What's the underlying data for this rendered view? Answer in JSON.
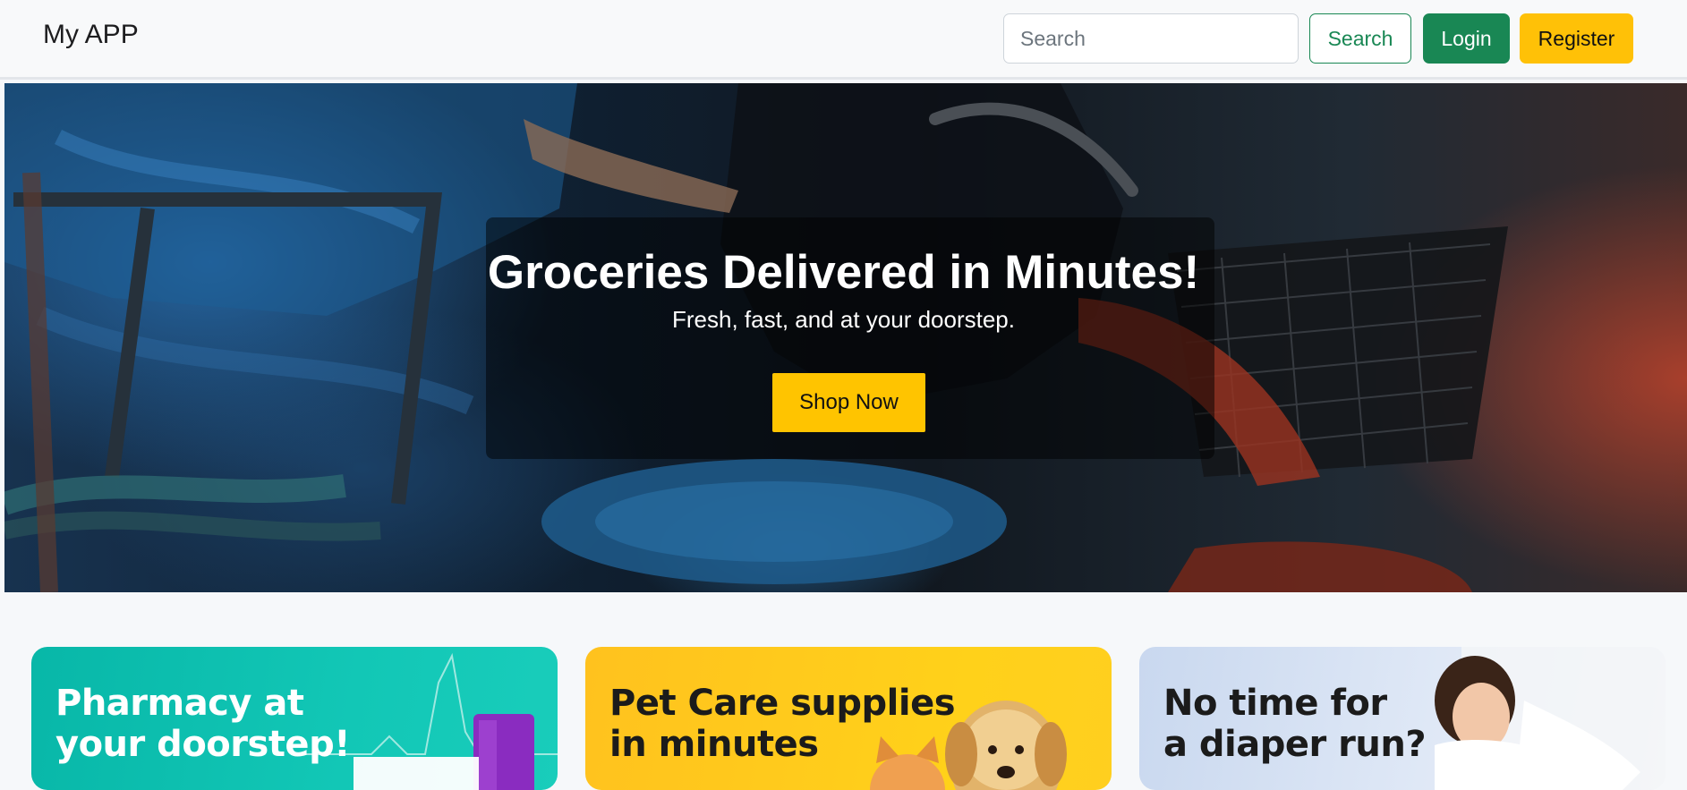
{
  "navbar": {
    "brand": "My APP",
    "search_placeholder": "Search",
    "search_button": "Search",
    "login_button": "Login",
    "register_button": "Register"
  },
  "hero": {
    "title": "Groceries Delivered in Minutes!",
    "subtitle": "Fresh, fast, and at your doorstep.",
    "cta": "Shop Now"
  },
  "cards": [
    {
      "line1": "Pharmacy at",
      "line2": "your doorstep!"
    },
    {
      "line1": "Pet Care supplies",
      "line2": "in minutes"
    },
    {
      "line1": "No time for",
      "line2": "a diaper run?"
    }
  ],
  "colors": {
    "success": "#198754",
    "warning": "#ffc107",
    "pharmacy": "#12c7b6",
    "pet": "#ffd11a",
    "baby": "#dfe8f6"
  }
}
